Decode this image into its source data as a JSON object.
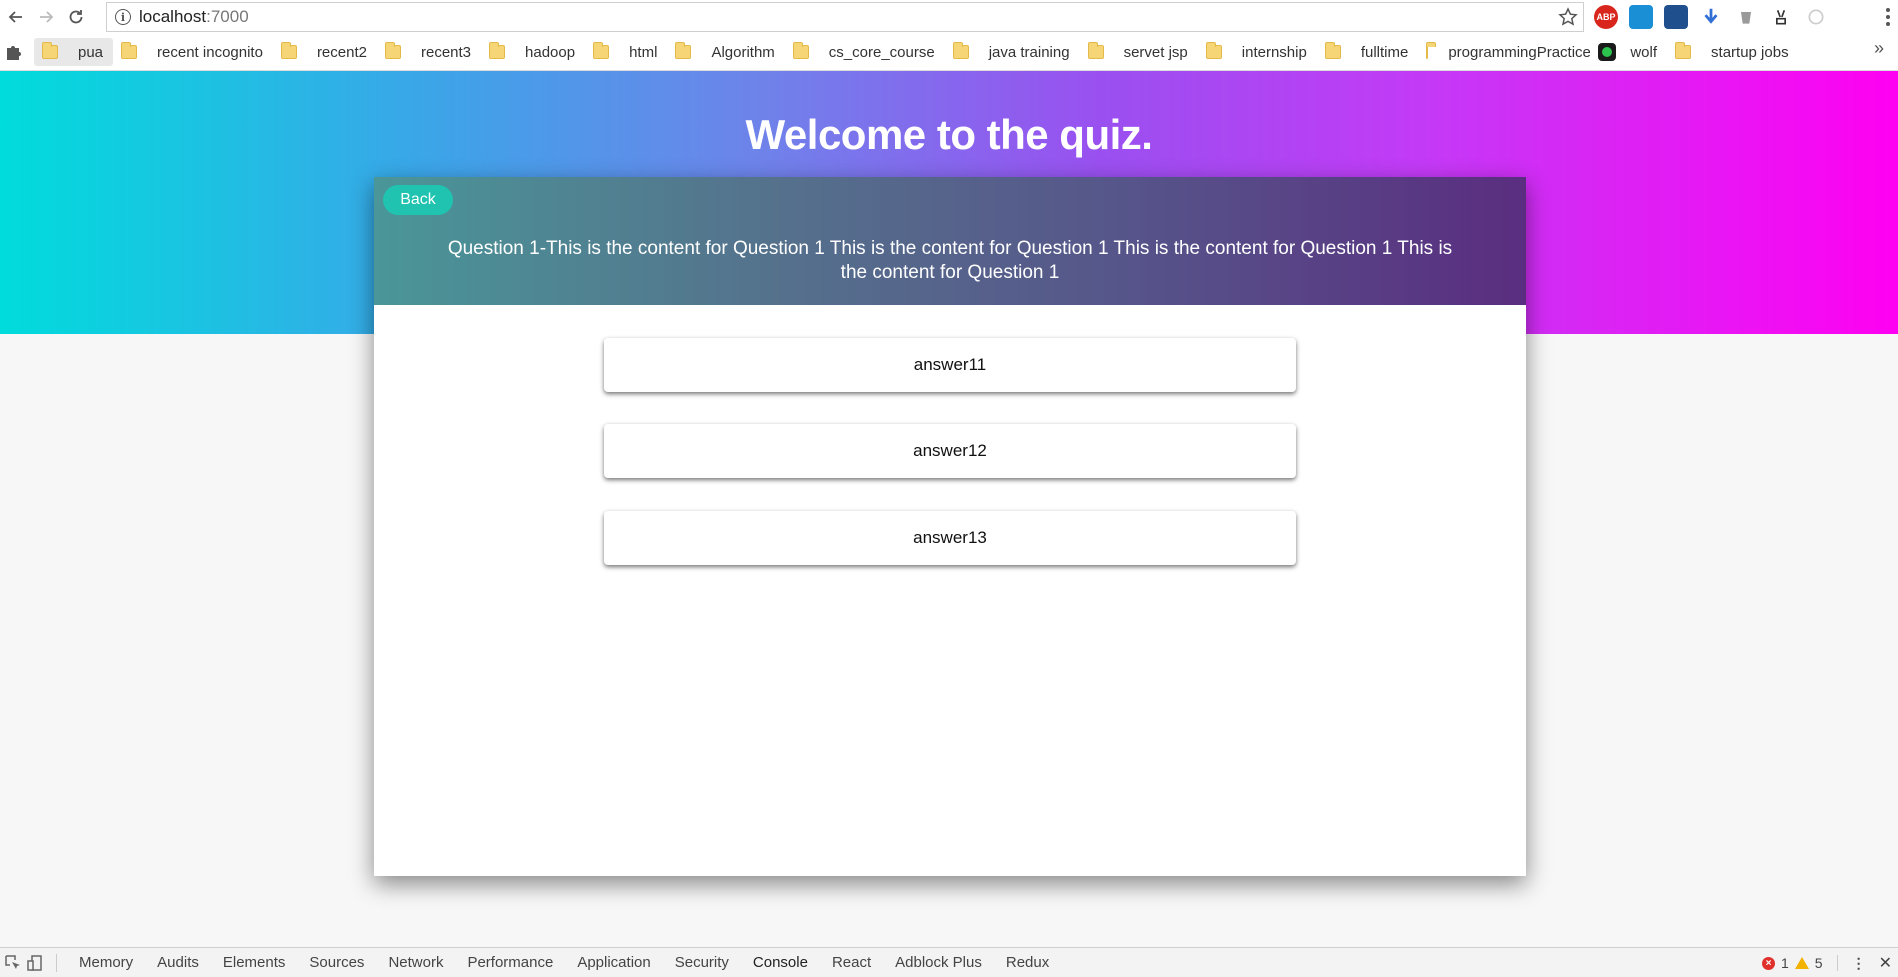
{
  "browser": {
    "url_host": "localhost",
    "url_port": ":7000",
    "bookmarks": [
      {
        "label": "pua"
      },
      {
        "label": "recent incognito"
      },
      {
        "label": "recent2"
      },
      {
        "label": "recent3"
      },
      {
        "label": "hadoop"
      },
      {
        "label": "html"
      },
      {
        "label": "Algorithm"
      },
      {
        "label": "cs_core_course"
      },
      {
        "label": "java training"
      },
      {
        "label": "servet jsp"
      },
      {
        "label": "internship"
      },
      {
        "label": "fulltime"
      },
      {
        "label": "programmingPractice"
      },
      {
        "label": "wolf"
      },
      {
        "label": "startup jobs"
      }
    ],
    "overflow_glyph": "»",
    "extensions": [
      "adblock-plus-icon",
      "window-icon",
      "chart-icon",
      "download-icon",
      "cup-icon",
      "peace-icon",
      "circle-icon"
    ],
    "abp_text": "ABP"
  },
  "page": {
    "title": "Welcome to the quiz.",
    "back_label": "Back",
    "question": "Question 1-This is the content for Question 1 This is the content for Question 1 This is the content for Question 1 This is the content for Question 1",
    "answers": [
      "answer11",
      "answer12",
      "answer13"
    ],
    "colors": {
      "hero_start": "#00dcdc",
      "hero_end": "#ff00f2",
      "back_button": "#1fc3b0"
    }
  },
  "devtools": {
    "tabs": [
      "Memory",
      "Audits",
      "Elements",
      "Sources",
      "Network",
      "Performance",
      "Application",
      "Security",
      "Console",
      "React",
      "Adblock Plus",
      "Redux"
    ],
    "error_count": "1",
    "warning_count": "5",
    "close_glyph": "✕"
  }
}
